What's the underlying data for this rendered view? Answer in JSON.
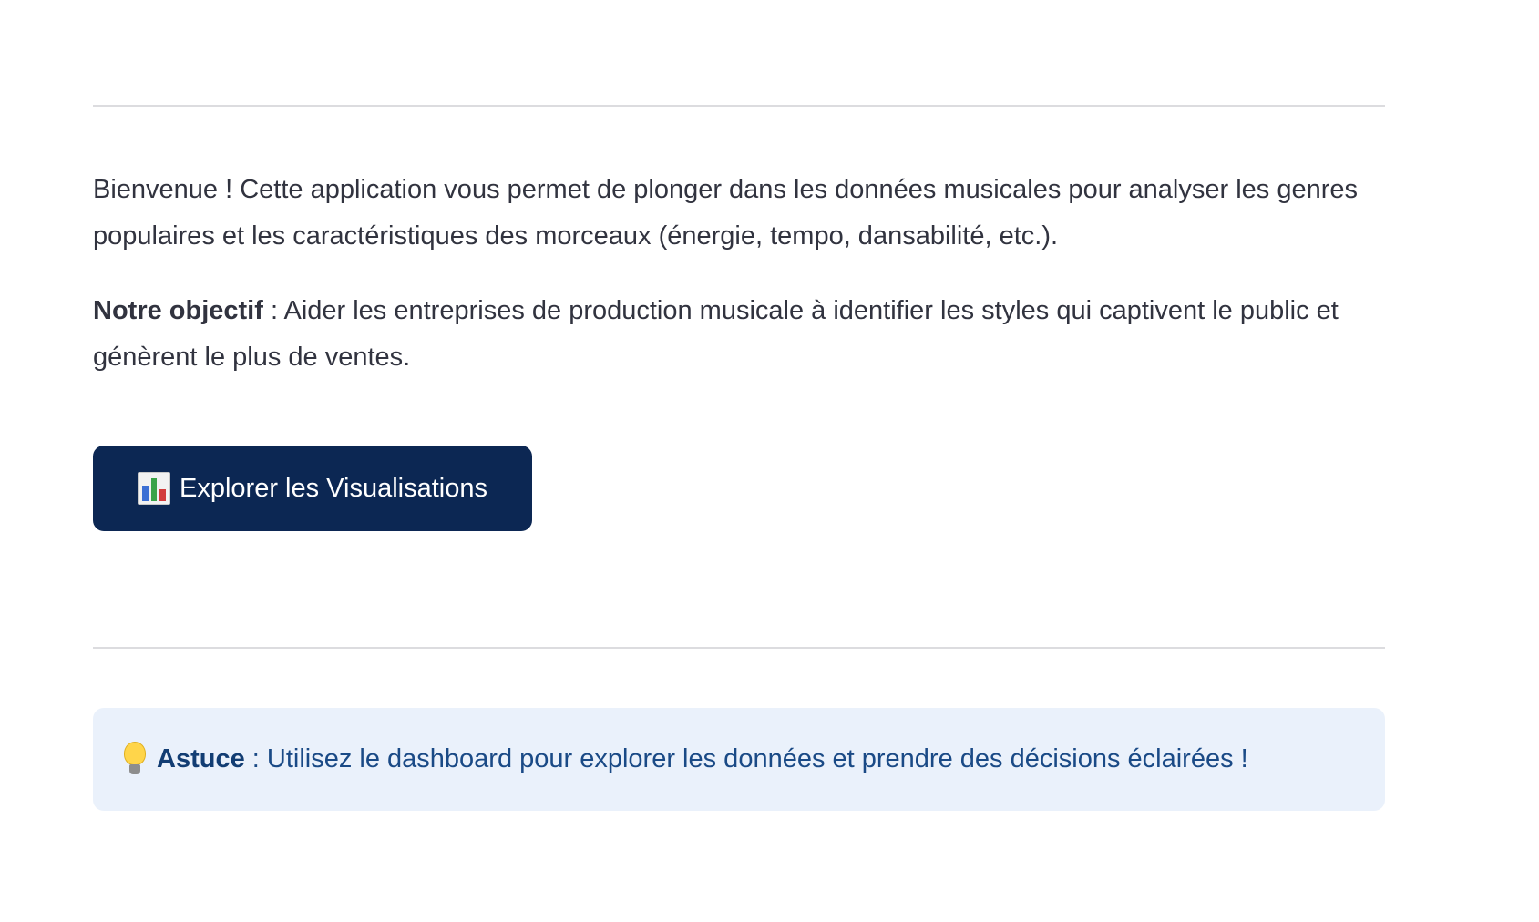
{
  "intro": {
    "text": "Bienvenue ! Cette application vous permet de plonger dans les données musicales pour analyser les genres populaires et les caractéristiques des morceaux (énergie, tempo, dansabilité, etc.)."
  },
  "goal": {
    "label": "Notre objectif",
    "text": " : Aider les entreprises de production musicale à identifier les styles qui captivent le public et génèrent le plus de ventes."
  },
  "button": {
    "icon": "bar-chart-icon",
    "label": "Explorer les Visualisations",
    "background": "#0c2753"
  },
  "tip": {
    "icon": "lightbulb-icon",
    "label": "Astuce",
    "text": " : Utilisez le dashboard pour explorer les données et prendre des décisions éclairées !",
    "background": "#eaf1fb",
    "text_color": "#1a4a86"
  }
}
